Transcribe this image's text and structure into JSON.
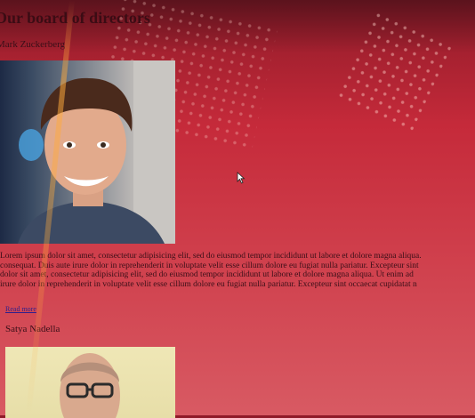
{
  "page": {
    "title": "Our board of directors"
  },
  "directors": [
    {
      "name": "Mark Zuckerberg",
      "bio_lines": [
        "Lorem ipsum dolor sit amet, consectetur adipisicing elit, sed do eiusmod tempor incididunt ut labore et dolore magna aliqua.",
        "consequat. Duis aute irure dolor in reprehenderit in voluptate velit esse cillum dolore eu fugiat nulla pariatur. Excepteur sint",
        "dolor sit amet, consectetur adipisicing elit, sed do eiusmod tempor incididunt ut labore et dolore magna aliqua. Ut enim ad",
        "irure dolor in reprehenderit in voluptate velit esse cillum dolore eu fugiat nulla pariatur. Excepteur sint occaecat cupidatat n"
      ],
      "link_label": "Read more"
    },
    {
      "name": "Satya Nadella"
    }
  ],
  "colors": {
    "background": "#c52a3a",
    "text": "#3a0f18",
    "link": "#2f1f8c"
  }
}
